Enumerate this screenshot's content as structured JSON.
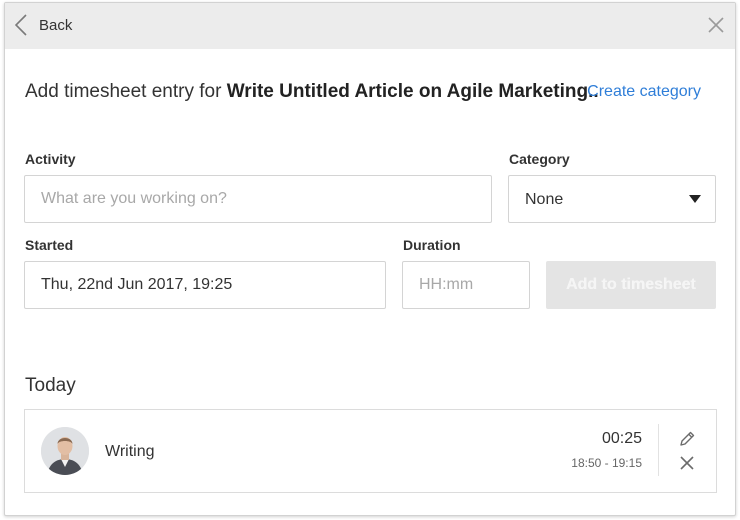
{
  "header": {
    "back_label": "Back",
    "back_icon": "chevron-left-icon",
    "close_icon": "close-icon"
  },
  "heading": {
    "prefix": "Add timesheet entry for ",
    "task_title": "Write Untitled Article on Agile Marketing..",
    "create_category_label": "Create category"
  },
  "form": {
    "activity_label": "Activity",
    "activity_placeholder": "What are you working on?",
    "activity_value": "",
    "category_label": "Category",
    "category_value": "None",
    "started_label": "Started",
    "started_value": "Thu, 22nd Jun 2017, 19:25",
    "duration_label": "Duration",
    "duration_placeholder": "HH:mm",
    "duration_value": "",
    "add_button_label": "Add to timesheet"
  },
  "today": {
    "heading": "Today",
    "entries": [
      {
        "activity": "Writing",
        "duration": "00:25",
        "time_range": "18:50 - 19:15",
        "edit_icon": "pencil-icon",
        "delete_icon": "close-icon"
      }
    ]
  },
  "colors": {
    "accent": "#2f7ed8",
    "topbar_bg": "#ececec",
    "disabled_button_bg": "#e4e4e4"
  }
}
